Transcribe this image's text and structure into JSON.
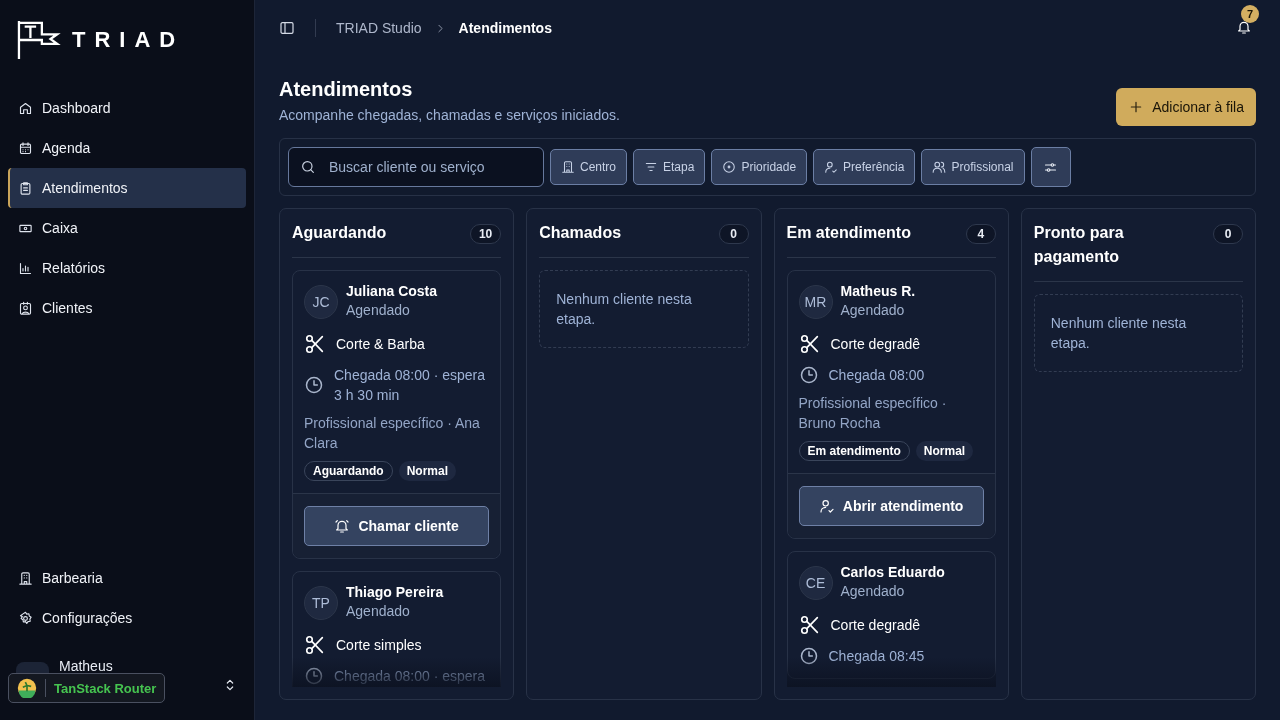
{
  "sidebar": {
    "brand": "TRIAD",
    "nav": [
      {
        "label": "Dashboard",
        "selected": false
      },
      {
        "label": "Agenda",
        "selected": false
      },
      {
        "label": "Atendimentos",
        "selected": true
      },
      {
        "label": "Caixa",
        "selected": false
      },
      {
        "label": "Relatórios",
        "selected": false
      },
      {
        "label": "Clientes",
        "selected": false
      }
    ],
    "footer_nav": [
      {
        "label": "Barbearia",
        "selected": false
      },
      {
        "label": "Configurações",
        "selected": false
      }
    ],
    "user": {
      "name": "Matheus"
    },
    "devtools_badge": "TanStack Router"
  },
  "header": {
    "breadcrumb": [
      "TRIAD Studio",
      "Atendimentos"
    ],
    "notifications": "7"
  },
  "page": {
    "title": "Atendimentos",
    "subtitle": "Acompanhe chegadas, chamadas e serviços iniciados.",
    "primary_action": "Adicionar à fila"
  },
  "filters": {
    "search_placeholder": "Buscar cliente ou serviço",
    "chips": [
      {
        "label": "Centro"
      },
      {
        "label": "Etapa"
      },
      {
        "label": "Prioridade"
      },
      {
        "label": "Preferência"
      },
      {
        "label": "Profissional"
      }
    ]
  },
  "columns": [
    {
      "title": "Aguardando",
      "count": "10",
      "cards": [
        {
          "initials": "JC",
          "name": "Juliana Costa",
          "status": "Agendado",
          "service": "Corte & Barba",
          "arrival": "Chegada 08:00 · espera 3 h 30 min",
          "preference": "Profissional específico · Ana Clara",
          "tags": [
            {
              "label": "Aguardando",
              "kind": "outline"
            },
            {
              "label": "Normal",
              "kind": "filled"
            }
          ],
          "action": {
            "label": "Chamar cliente",
            "kind": "call"
          }
        },
        {
          "initials": "TP",
          "name": "Thiago Pereira",
          "status": "Agendado",
          "service": "Corte simples",
          "arrival": "Chegada 08:00 · espera"
        }
      ]
    },
    {
      "title": "Chamados",
      "count": "0",
      "empty": "Nenhum cliente nesta etapa."
    },
    {
      "title": "Em atendimento",
      "count": "4",
      "cards": [
        {
          "initials": "MR",
          "name": "Matheus R.",
          "status": "Agendado",
          "service": "Corte degradê",
          "arrival": "Chegada 08:00",
          "preference": "Profissional específico · Bruno Rocha",
          "tags": [
            {
              "label": "Em atendimento",
              "kind": "outline"
            },
            {
              "label": "Normal",
              "kind": "filled"
            }
          ],
          "action": {
            "label": "Abrir atendimento",
            "kind": "open"
          }
        },
        {
          "initials": "CE",
          "name": "Carlos Eduardo",
          "status": "Agendado",
          "service": "Corte degradê",
          "arrival": "Chegada 08:45"
        }
      ]
    },
    {
      "title": "Pronto para pagamento",
      "count": "0",
      "empty": "Nenhum cliente nesta etapa."
    }
  ]
}
